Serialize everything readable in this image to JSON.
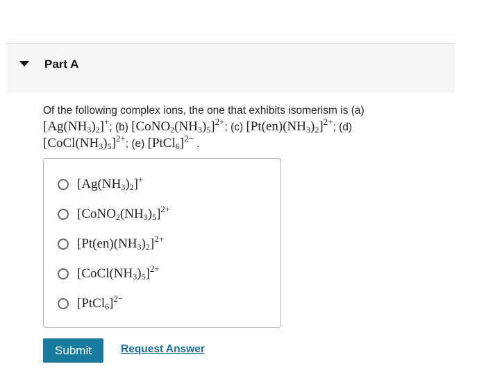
{
  "part": {
    "title": "Part A"
  },
  "question": {
    "intro": "Of the following complex ions, the one that exhibits isomerism is",
    "labels": [
      "(a)",
      "(b)",
      "(c)",
      "(d)",
      "(e)"
    ],
    "separator": ";",
    "end": "."
  },
  "options": [
    {
      "formula": "[Ag(NH3)2]+",
      "label": "[Ag(NH3)2]+"
    },
    {
      "formula": "[CoNO2(NH3)5]2+",
      "label": "[CoNO2(NH3)5]2+"
    },
    {
      "formula": "[Pt(en)(NH3)2]2+",
      "label": "[Pt(en)(NH3)2]2+"
    },
    {
      "formula": "[CoCl(NH3)5]2+",
      "label": "[CoCl(NH3)5]2+"
    },
    {
      "formula": "[PtCl6]2-",
      "label": "[PtCl6]2−"
    }
  ],
  "buttons": {
    "submit": "Submit",
    "request_answer": "Request Answer"
  },
  "colors": {
    "submit_bg": "#197aa0",
    "link": "#1a6fa0"
  },
  "icons": {
    "header_toggle": "caret-down-icon",
    "option_radio": "radio-unselected-icon"
  }
}
